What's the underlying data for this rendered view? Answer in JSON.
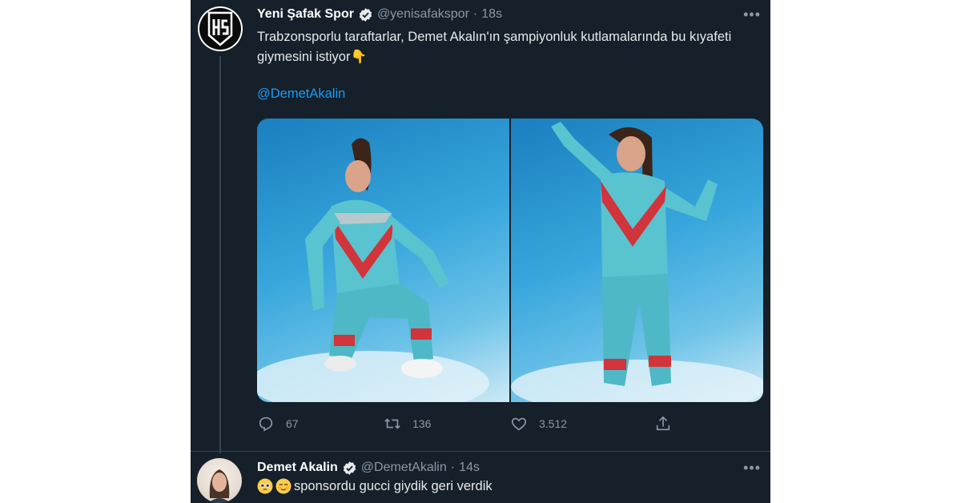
{
  "tweet": {
    "author_name": "Yeni Şafak Spor",
    "handle": "@yenisafakspor",
    "separator": "·",
    "time": "18s",
    "text": "Trabzonsporlu taraftarlar, Demet Akalın'ın şampiyonluk kutlamalarında bu kıyafeti giymesini istiyor👇",
    "mention": "@DemetAkalin",
    "avatar_icon": "ys-logo-icon",
    "avatar_lettering": "YS",
    "actions": {
      "reply_count": "67",
      "retweet_count": "136",
      "like_count": "3.512"
    },
    "media": [
      "photo-kneeling-tracksuit",
      "photo-standing-tracksuit"
    ]
  },
  "reply": {
    "author_name": "Demet Akalin",
    "handle": "@DemetAkalin",
    "separator": "·",
    "time": "14s",
    "text": "sponsordu gucci giydik geri verdik",
    "emojis": [
      "pleading-face-emoji",
      "smiling-face-emoji"
    ]
  },
  "colors": {
    "background": "#15202b",
    "text": "#e7e9ea",
    "secondary": "#8b98a5",
    "link": "#1d9bf0",
    "divider": "#38444d"
  }
}
